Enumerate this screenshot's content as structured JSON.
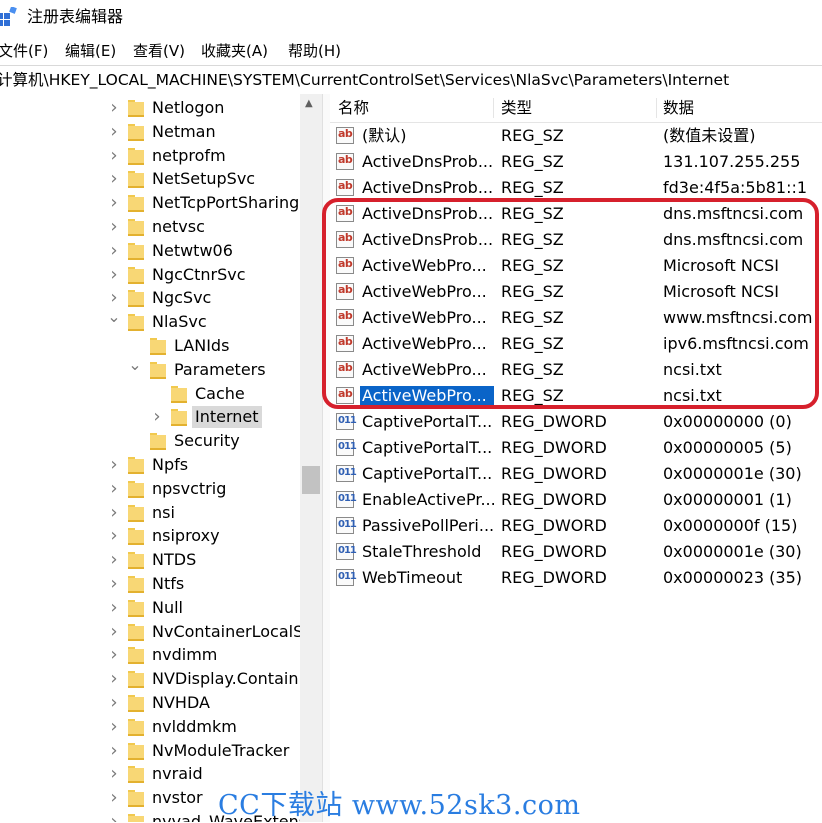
{
  "window": {
    "title": "注册表编辑器"
  },
  "menu": [
    "文件(F)",
    "编辑(E)",
    "查看(V)",
    "收藏夹(A)",
    "帮助(H)"
  ],
  "address": "计算机\\HKEY_LOCAL_MACHINE\\SYSTEM\\CurrentControlSet\\Services\\NlaSvc\\Parameters\\Internet",
  "tree": [
    {
      "label": "Netlogon",
      "level": 0,
      "expand": "collapsed"
    },
    {
      "label": "Netman",
      "level": 0,
      "expand": "collapsed"
    },
    {
      "label": "netprofm",
      "level": 0,
      "expand": "collapsed"
    },
    {
      "label": "NetSetupSvc",
      "level": 0,
      "expand": "collapsed"
    },
    {
      "label": "NetTcpPortSharing",
      "level": 0,
      "expand": "collapsed"
    },
    {
      "label": "netvsc",
      "level": 0,
      "expand": "collapsed"
    },
    {
      "label": "Netwtw06",
      "level": 0,
      "expand": "collapsed"
    },
    {
      "label": "NgcCtnrSvc",
      "level": 0,
      "expand": "collapsed"
    },
    {
      "label": "NgcSvc",
      "level": 0,
      "expand": "collapsed"
    },
    {
      "label": "NlaSvc",
      "level": 0,
      "expand": "expanded"
    },
    {
      "label": "LANIds",
      "level": 1,
      "expand": "none"
    },
    {
      "label": "Parameters",
      "level": 1,
      "expand": "expanded"
    },
    {
      "label": "Cache",
      "level": 2,
      "expand": "none"
    },
    {
      "label": "Internet",
      "level": 2,
      "expand": "collapsed",
      "selected": true
    },
    {
      "label": "Security",
      "level": 1,
      "expand": "none"
    },
    {
      "label": "Npfs",
      "level": 0,
      "expand": "collapsed"
    },
    {
      "label": "npsvctrig",
      "level": 0,
      "expand": "collapsed"
    },
    {
      "label": "nsi",
      "level": 0,
      "expand": "collapsed"
    },
    {
      "label": "nsiproxy",
      "level": 0,
      "expand": "collapsed"
    },
    {
      "label": "NTDS",
      "level": 0,
      "expand": "collapsed"
    },
    {
      "label": "Ntfs",
      "level": 0,
      "expand": "collapsed"
    },
    {
      "label": "Null",
      "level": 0,
      "expand": "collapsed"
    },
    {
      "label": "NvContainerLocalS",
      "level": 0,
      "expand": "collapsed"
    },
    {
      "label": "nvdimm",
      "level": 0,
      "expand": "collapsed"
    },
    {
      "label": "NVDisplay.Contain",
      "level": 0,
      "expand": "collapsed"
    },
    {
      "label": "NVHDA",
      "level": 0,
      "expand": "collapsed"
    },
    {
      "label": "nvlddmkm",
      "level": 0,
      "expand": "collapsed"
    },
    {
      "label": "NvModuleTracker",
      "level": 0,
      "expand": "collapsed"
    },
    {
      "label": "nvraid",
      "level": 0,
      "expand": "collapsed"
    },
    {
      "label": "nvstor",
      "level": 0,
      "expand": "collapsed"
    },
    {
      "label": "nvvad_WaveExtens",
      "level": 0,
      "expand": "collapsed"
    }
  ],
  "columns": {
    "name": "名称",
    "type": "类型",
    "data": "数据"
  },
  "values": [
    {
      "icon": "ab",
      "name": "(默认)",
      "type": "REG_SZ",
      "data": "(数值未设置)"
    },
    {
      "icon": "ab",
      "name": "ActiveDnsProb...",
      "type": "REG_SZ",
      "data": "131.107.255.255"
    },
    {
      "icon": "ab",
      "name": "ActiveDnsProb...",
      "type": "REG_SZ",
      "data": "fd3e:4f5a:5b81::1"
    },
    {
      "icon": "ab",
      "name": "ActiveDnsProb...",
      "type": "REG_SZ",
      "data": "dns.msftncsi.com"
    },
    {
      "icon": "ab",
      "name": "ActiveDnsProb...",
      "type": "REG_SZ",
      "data": "dns.msftncsi.com"
    },
    {
      "icon": "ab",
      "name": "ActiveWebPro...",
      "type": "REG_SZ",
      "data": "Microsoft NCSI"
    },
    {
      "icon": "ab",
      "name": "ActiveWebPro...",
      "type": "REG_SZ",
      "data": "Microsoft NCSI"
    },
    {
      "icon": "ab",
      "name": "ActiveWebPro...",
      "type": "REG_SZ",
      "data": "www.msftncsi.com"
    },
    {
      "icon": "ab",
      "name": "ActiveWebPro...",
      "type": "REG_SZ",
      "data": "ipv6.msftncsi.com"
    },
    {
      "icon": "ab",
      "name": "ActiveWebPro...",
      "type": "REG_SZ",
      "data": "ncsi.txt"
    },
    {
      "icon": "ab",
      "name": "ActiveWebPro...",
      "type": "REG_SZ",
      "data": "ncsi.txt",
      "selected": true
    },
    {
      "icon": "dword",
      "name": "CaptivePortalT...",
      "type": "REG_DWORD",
      "data": "0x00000000 (0)"
    },
    {
      "icon": "dword",
      "name": "CaptivePortalT...",
      "type": "REG_DWORD",
      "data": "0x00000005 (5)"
    },
    {
      "icon": "dword",
      "name": "CaptivePortalT...",
      "type": "REG_DWORD",
      "data": "0x0000001e (30)"
    },
    {
      "icon": "dword",
      "name": "EnableActivePr...",
      "type": "REG_DWORD",
      "data": "0x00000001 (1)"
    },
    {
      "icon": "dword",
      "name": "PassivePollPeri...",
      "type": "REG_DWORD",
      "data": "0x0000000f (15)"
    },
    {
      "icon": "dword",
      "name": "StaleThreshold",
      "type": "REG_DWORD",
      "data": "0x0000001e (30)"
    },
    {
      "icon": "dword",
      "name": "WebTimeout",
      "type": "REG_DWORD",
      "data": "0x00000023 (35)"
    }
  ],
  "icon_text": {
    "ab": "ab",
    "dword": "011"
  },
  "colors": {
    "highlight": "#d6202c",
    "selection": "#0a64c8",
    "folder": "#f8d775"
  },
  "watermark": "CC下载站 www.52sk3.com"
}
